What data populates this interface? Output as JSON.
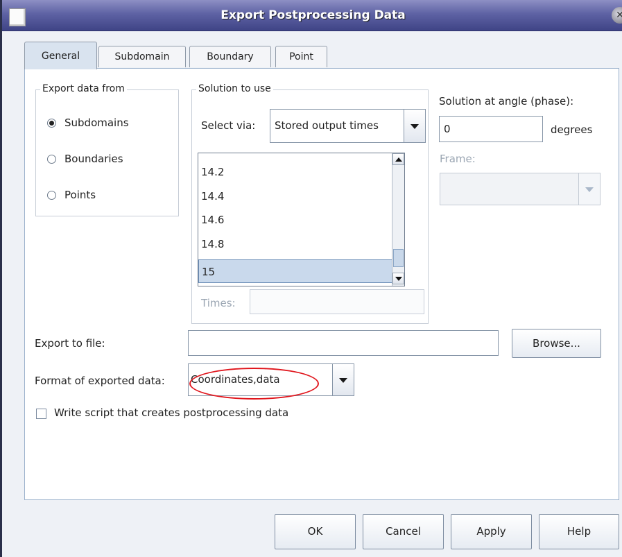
{
  "window": {
    "title": "Export Postprocessing Data"
  },
  "tabs": [
    {
      "label": "General"
    },
    {
      "label": "Subdomain"
    },
    {
      "label": "Boundary"
    },
    {
      "label": "Point"
    }
  ],
  "export_from": {
    "title": "Export data from",
    "options": [
      {
        "label": "Subdomains",
        "checked": true
      },
      {
        "label": "Boundaries",
        "checked": false
      },
      {
        "label": "Points",
        "checked": false
      }
    ]
  },
  "solution": {
    "title": "Solution to use",
    "select_via_label": "Select via:",
    "select_via_value": "Stored output times",
    "times_list": [
      "14.2",
      "14.4",
      "14.6",
      "14.8",
      "15"
    ],
    "selected_time": "15",
    "times_label": "Times:",
    "times_value": ""
  },
  "angle": {
    "label": "Solution at angle (phase):",
    "value": "0",
    "unit": "degrees",
    "frame_label": "Frame:",
    "frame_value": ""
  },
  "export_file": {
    "label": "Export to file:",
    "value": "",
    "browse_label": "Browse..."
  },
  "format": {
    "label": "Format of exported data:",
    "value": "Coordinates,data"
  },
  "write_script": {
    "label": "Write script that creates postprocessing data",
    "checked": false
  },
  "buttons": {
    "ok": "OK",
    "cancel": "Cancel",
    "apply": "Apply",
    "help": "Help"
  },
  "colors": {
    "title_bar": "#5e62a4",
    "selection": "#c9d9ec",
    "annotation": "#e0161d"
  }
}
